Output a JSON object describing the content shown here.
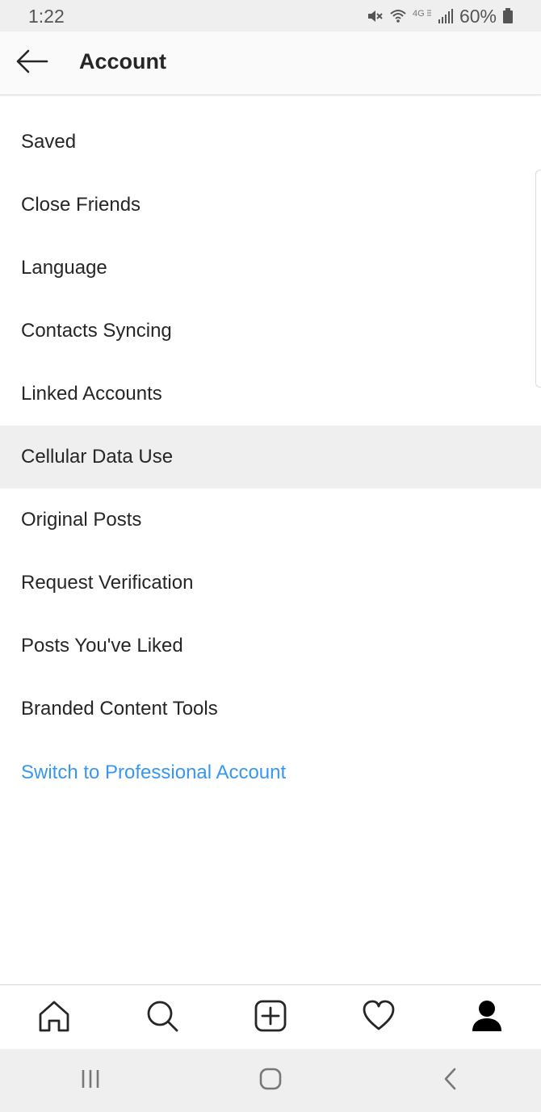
{
  "status_bar": {
    "time": "1:22",
    "battery": "60%",
    "icons": [
      "mute-icon",
      "wifi-icon",
      "4g-icon",
      "signal-icon",
      "battery-icon"
    ]
  },
  "header": {
    "title": "Account",
    "back_icon": "arrow-left-icon"
  },
  "menu": {
    "items": [
      {
        "label": "Saved"
      },
      {
        "label": "Close Friends"
      },
      {
        "label": "Language"
      },
      {
        "label": "Contacts Syncing"
      },
      {
        "label": "Linked Accounts"
      },
      {
        "label": "Cellular Data Use",
        "highlighted": true
      },
      {
        "label": "Original Posts"
      },
      {
        "label": "Request Verification"
      },
      {
        "label": "Posts You've Liked"
      },
      {
        "label": "Branded Content Tools"
      }
    ],
    "link": {
      "label": "Switch to Professional Account"
    }
  },
  "tab_bar": {
    "tabs": [
      {
        "icon": "home-icon"
      },
      {
        "icon": "search-icon"
      },
      {
        "icon": "add-post-icon"
      },
      {
        "icon": "heart-icon"
      },
      {
        "icon": "profile-icon",
        "active": true
      }
    ]
  },
  "nav_bar": {
    "buttons": [
      {
        "icon": "recent-apps-icon"
      },
      {
        "icon": "home-button-icon"
      },
      {
        "icon": "back-chevron-icon"
      }
    ]
  },
  "colors": {
    "accent": "#3897f0",
    "text": "#262626",
    "highlight_bg": "#efefef",
    "status_bg": "#efefef"
  }
}
